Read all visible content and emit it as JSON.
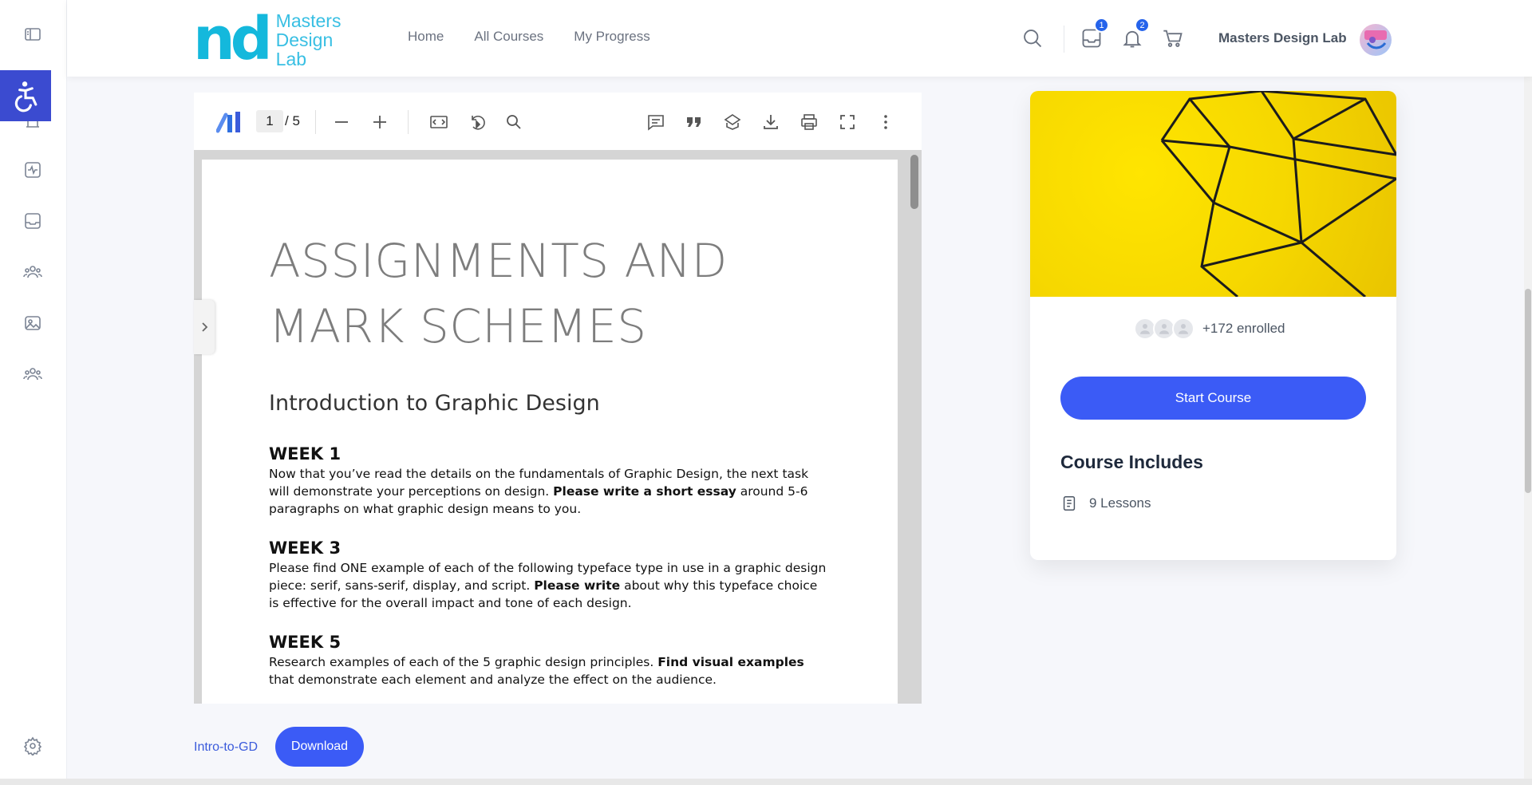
{
  "logo": {
    "mark": "nd",
    "line1": "Masters",
    "line2": "Design",
    "line3": "Lab"
  },
  "nav": [
    {
      "label": "Home"
    },
    {
      "label": "All Courses"
    },
    {
      "label": "My Progress"
    }
  ],
  "header": {
    "inbox_badge": "1",
    "notifications_badge": "2",
    "user_name": "Masters Design Lab"
  },
  "sidebar_icons": [
    "sidebar-toggle-icon",
    "accessibility-icon",
    "course-icon",
    "activity-icon",
    "inbox-icon",
    "groups-icon",
    "media-icon",
    "members-icon",
    "settings-icon"
  ],
  "viewer": {
    "current_page": "1",
    "total_pages": "/ 5"
  },
  "document": {
    "title_line1": "ASSIGNMENTS AND",
    "title_line2": "MARK SCHEMES",
    "subtitle": "Introduction to Graphic Design",
    "weeks": [
      {
        "heading": "WEEK 1",
        "pre": "Now that you’ve read the details on the fundamentals of Graphic Design, the next task will demonstrate your perceptions on design. ",
        "bold": "Please write a short essay",
        "post": " around 5-6 paragraphs on what graphic design means to you."
      },
      {
        "heading": "WEEK 3",
        "pre": "Please find ONE example of each of the following typeface type in use in a graphic design piece: serif, sans-serif, display, and script. ",
        "bold": "Please write",
        "post": " about why this typeface choice is effective for the overall impact and tone of each design."
      },
      {
        "heading": "WEEK 5",
        "pre": "Research examples of each of the 5 graphic design principles. ",
        "bold": "Find visual examples",
        "post": " that demonstrate each element and analyze the effect on the audience."
      }
    ]
  },
  "attachment": {
    "file_name": "Intro-to-GD",
    "download_label": "Download"
  },
  "course_card": {
    "enrolled_text": "+172 enrolled",
    "start_label": "Start Course",
    "includes_heading": "Course Includes",
    "lessons_text": "9 Lessons"
  },
  "colors": {
    "brand": "#14b8dc",
    "primary": "#3b5bf6",
    "accessibility": "#3b4bd0",
    "card_image": "#f6d800"
  }
}
